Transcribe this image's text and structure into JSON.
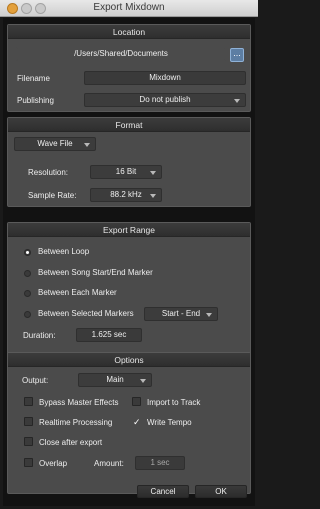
{
  "window": {
    "title": "Export Mixdown"
  },
  "location": {
    "header": "Location",
    "path": "/Users/Shared/Documents",
    "browse_label": "...",
    "filename_label": "Filename",
    "filename_value": "Mixdown",
    "publishing_label": "Publishing",
    "publishing_value": "Do not publish"
  },
  "format": {
    "header": "Format",
    "file_type": "Wave File",
    "resolution_label": "Resolution:",
    "resolution_value": "16 Bit",
    "sample_rate_label": "Sample Rate:",
    "sample_rate_value": "88.2 kHz"
  },
  "export_range": {
    "header": "Export Range",
    "options": [
      {
        "label": "Between Loop",
        "selected": true
      },
      {
        "label": "Between Song Start/End Marker",
        "selected": false
      },
      {
        "label": "Between Each Marker",
        "selected": false
      },
      {
        "label": "Between Selected Markers",
        "selected": false
      }
    ],
    "markers_value": "Start - End",
    "duration_label": "Duration:",
    "duration_value": "1.625 sec"
  },
  "options": {
    "header": "Options",
    "output_label": "Output:",
    "output_value": "Main",
    "bypass_master_effects": "Bypass Master Effects",
    "import_to_track": "Import to Track",
    "realtime_processing": "Realtime Processing",
    "write_tempo": "Write Tempo",
    "write_tempo_check": "✓",
    "close_after_export": "Close after export",
    "overlap": "Overlap",
    "amount_label": "Amount:",
    "amount_value": "1 sec"
  },
  "footer": {
    "cancel_label": "Cancel",
    "ok_label": "OK"
  },
  "colors": {
    "accent": "#5d7ea3",
    "panel": "#4b4b4b",
    "background": "#121212",
    "close_button": "#e3a03c"
  }
}
